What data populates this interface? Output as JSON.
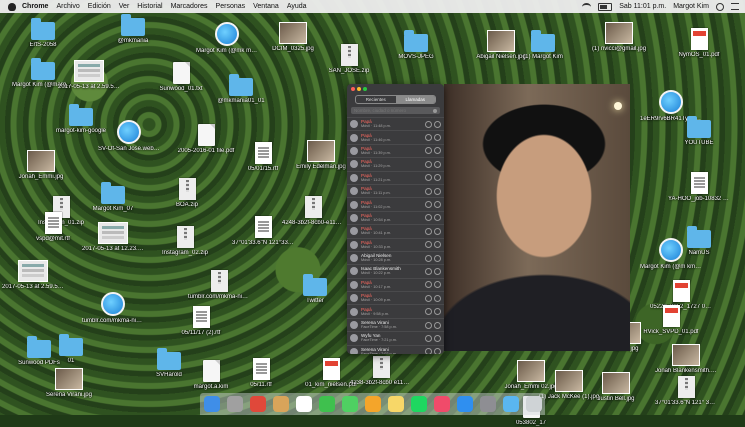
{
  "menubar": {
    "app": "Chrome",
    "items": [
      "Archivo",
      "Edición",
      "Ver",
      "Historial",
      "Marcadores",
      "Personas",
      "Ventana",
      "Ayuda"
    ],
    "clock": "Sab 11:01 p.m.",
    "user": "Margot Kim"
  },
  "desktop_icons": [
    {
      "label": "ErtS-2058",
      "type": "folder"
    },
    {
      "label": "@mkmania",
      "type": "folder"
    },
    {
      "label": "Margot Kim (@mk mania01) _ Twitt er.webloc",
      "type": "webloc"
    },
    {
      "label": "DCIM_0325.jpg",
      "type": "photo"
    },
    {
      "label": "SAN_JOSE.zip",
      "type": "zip"
    },
    {
      "label": "MOVS-JPEG",
      "type": "folder"
    },
    {
      "label": "Abigail Nielsen.jpg",
      "type": "photo"
    },
    {
      "label": "(1) Margot Kim",
      "type": "folder"
    },
    {
      "label": "(1) nvicci@gmail.jpg",
      "type": "photo"
    },
    {
      "label": "NymOS_01.pdf",
      "type": "pdf"
    },
    {
      "label": "Margot Kim (@margotkim) Twitter",
      "type": "folder"
    },
    {
      "label": "2017-05-13 at 2.59.54 PM.png",
      "type": "shot"
    },
    {
      "label": "Sunwood_01.txt",
      "type": "doc"
    },
    {
      "label": "@mkmania01_01",
      "type": "folder"
    },
    {
      "label": "margot-kim-google",
      "type": "folder"
    },
    {
      "label": "SV-Of-San Jose.webloc",
      "type": "webloc"
    },
    {
      "label": "2005-2016-01 file.pdf",
      "type": "doc"
    },
    {
      "label": "05/01/15.rtf",
      "type": "rtf"
    },
    {
      "label": "Emily Edelman.jpg",
      "type": "photo"
    },
    {
      "label": "1eER9rv6BR41Ty ru2Vdx0l9 ShaZAp-Beb30n",
      "type": "webloc"
    },
    {
      "label": "YOUTUBE",
      "type": "folder"
    },
    {
      "label": "Jonah_Emmi.jpg",
      "type": "photo"
    },
    {
      "label": "Instagram_01.zip",
      "type": "zip"
    },
    {
      "label": "Margot Kim_07",
      "type": "folder"
    },
    {
      "label": "BOA.zip",
      "type": "zip"
    },
    {
      "label": "4248-3b2f-8cb0-e11348ea430.zip",
      "type": "zip"
    },
    {
      "label": "37°01'33.6\"N 121°33.3\"W.rtf",
      "type": "rtf"
    },
    {
      "label": "vspd@mit.rtf",
      "type": "rtf"
    },
    {
      "label": "2017-05-13 at 12.23.18 PM.png",
      "type": "shot"
    },
    {
      "label": "Instagram_02.zip",
      "type": "zip"
    },
    {
      "label": "YA-HOO_job-10832 342f123889 1.rtf",
      "type": "rtf"
    },
    {
      "label": "NamUS",
      "type": "folder"
    },
    {
      "label": "2017-05-13 at 2.59.54 PM.png",
      "type": "shot"
    },
    {
      "label": "tumblr.com/mkma-nia01/06/23/old-8bcd.zip",
      "type": "zip"
    },
    {
      "label": "Twitter",
      "type": "folder"
    },
    {
      "label": "Margot Kim (@m kmania01) _ Twitter.webloc",
      "type": "webloc"
    },
    {
      "label": "05222_3052_1727 0836571959.rtf",
      "type": "pdf"
    },
    {
      "label": "tumblr.com/mkma-nia01/06/23/old-89 aold.webloc",
      "type": "webloc"
    },
    {
      "label": "05/11/17 (2).rtf",
      "type": "rtf"
    },
    {
      "label": "RVick_SVPD_01.pdf",
      "type": "pdf"
    },
    {
      "label": "01",
      "type": "folder"
    },
    {
      "label": "Sunwood PDFs",
      "type": "folder"
    },
    {
      "label": "SVHarold",
      "type": "folder"
    },
    {
      "label": "margot.a.kim",
      "type": "doc"
    },
    {
      "label": "05/11.rtf",
      "type": "rtf"
    },
    {
      "label": "01_kim_nielsen.pdf",
      "type": "pdf"
    },
    {
      "label": "Jonah_Emmi 02.jpg",
      "type": "photo"
    },
    {
      "label": "(1) Jack McKee (1).jpg",
      "type": "photo"
    },
    {
      "label": "Justin Bell.jpg",
      "type": "photo"
    },
    {
      "label": "Jonah Blankensmith.jpg",
      "type": "photo"
    },
    {
      "label": "Serena Virani.jpg",
      "type": "photo"
    },
    {
      "label": "37°01'33.6\"N 121° 33'3.3\"W.zip",
      "type": "zip"
    },
    {
      "label": "4238-3b2f-8cb0 e11348ea430",
      "type": "zip"
    },
    {
      "label": "1202.jpg",
      "type": "photo"
    },
    {
      "label": "053802_17",
      "type": "doc"
    }
  ],
  "phone": {
    "tabs": [
      "Recientes",
      "Llamadas"
    ],
    "search_placeholder": "Nombre, ciudad o número",
    "contacts": [
      {
        "name": "Papá",
        "sub": "Móvil · 11:48 p.m.",
        "missed": true
      },
      {
        "name": "Papá",
        "sub": "Móvil · 11:46 p.m.",
        "missed": true
      },
      {
        "name": "Papá",
        "sub": "Móvil · 11:39 p.m.",
        "missed": true
      },
      {
        "name": "Papá",
        "sub": "Móvil · 11:29 p.m.",
        "missed": true
      },
      {
        "name": "Papá",
        "sub": "Móvil · 11:21 p.m.",
        "missed": true
      },
      {
        "name": "Papá",
        "sub": "Móvil · 11:11 p.m.",
        "missed": true
      },
      {
        "name": "Papá",
        "sub": "Móvil · 11:02 p.m.",
        "missed": true
      },
      {
        "name": "Papá",
        "sub": "Móvil · 10:54 p.m.",
        "missed": true
      },
      {
        "name": "Papá",
        "sub": "Móvil · 10:41 p.m.",
        "missed": true
      },
      {
        "name": "Papá",
        "sub": "Móvil · 10:33 p.m.",
        "missed": true
      },
      {
        "name": "Abigail Nielsen",
        "sub": "Móvil · 10:28 p.m.",
        "missed": false
      },
      {
        "name": "Isaac Blankensmith",
        "sub": "Móvil · 10:22 p.m.",
        "missed": false
      },
      {
        "name": "Papá",
        "sub": "Móvil · 10:17 p.m.",
        "missed": true
      },
      {
        "name": "Papá",
        "sub": "Móvil · 10:09 p.m.",
        "missed": true
      },
      {
        "name": "Papá",
        "sub": "Móvil · 9:58 p.m.",
        "missed": true
      },
      {
        "name": "Serena Virani",
        "sub": "FaceTime · 7:58 p.m.",
        "missed": false
      },
      {
        "name": "Wyfu Yan",
        "sub": "FaceTime · 7:21 p.m.",
        "missed": false
      },
      {
        "name": "Serena Virani",
        "sub": "FaceTime · 7:02 p.m.",
        "missed": false
      }
    ]
  },
  "dock": {
    "apps": [
      "finder-icon",
      "launchpad-icon",
      "chrome-icon",
      "files-icon",
      "calendar-icon",
      "facetime-icon",
      "messages-icon",
      "photos-icon",
      "notes-icon",
      "spotify-icon",
      "music-icon",
      "appstore-icon",
      "preferences-icon",
      "downloads-icon",
      "trash-icon"
    ],
    "colors": [
      "#3f8ee8",
      "#a0a0a0",
      "#e0483a",
      "#d8a45a",
      "#ffffff",
      "#3fc04e",
      "#4fd062",
      "#f4a52a",
      "#f7d768",
      "#1ed760",
      "#f04b6a",
      "#2f8ff0",
      "#8e8e93",
      "#5ab6f0",
      "#cfd3d6"
    ]
  }
}
